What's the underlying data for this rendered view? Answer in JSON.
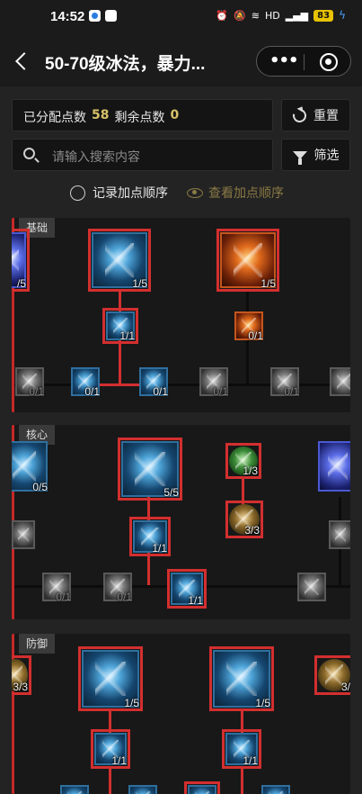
{
  "status": {
    "time": "14:52",
    "battery": "83"
  },
  "nav": {
    "title": "50-70级冰法，暴力..."
  },
  "points": {
    "allocated_label": "已分配点数",
    "allocated": "58",
    "remaining_label": "剩余点数",
    "remaining": "0"
  },
  "actions": {
    "reset": "重置",
    "filter": "筛选"
  },
  "search": {
    "placeholder": "请输入搜索内容"
  },
  "order": {
    "record": "记录加点顺序",
    "view": "查看加点顺序"
  },
  "sections": {
    "basic": {
      "label": "基础",
      "nodes": {
        "partial_left": "/5",
        "main_ice": "1/5",
        "main_fire": "1/5",
        "ice_mod": "1/1",
        "fire_mod": "0/1",
        "p1": "0/1",
        "p2": "0/1",
        "p3": "0/1",
        "p4": "0/1",
        "p5": "0/1"
      }
    },
    "core": {
      "label": "核心",
      "nodes": {
        "left": "0/5",
        "main": "5/5",
        "green": "1/3",
        "bronze": "3/3",
        "mod": "1/1",
        "sub_right": "1/1",
        "sub_a": "0/1",
        "sub_b": "0/1"
      }
    },
    "defense": {
      "label": "防御",
      "nodes": {
        "left": "3/3",
        "shield": "1/5",
        "star": "1/5",
        "right": "3/",
        "shield_mod": "1/1",
        "star_mod": "1/1"
      }
    }
  }
}
